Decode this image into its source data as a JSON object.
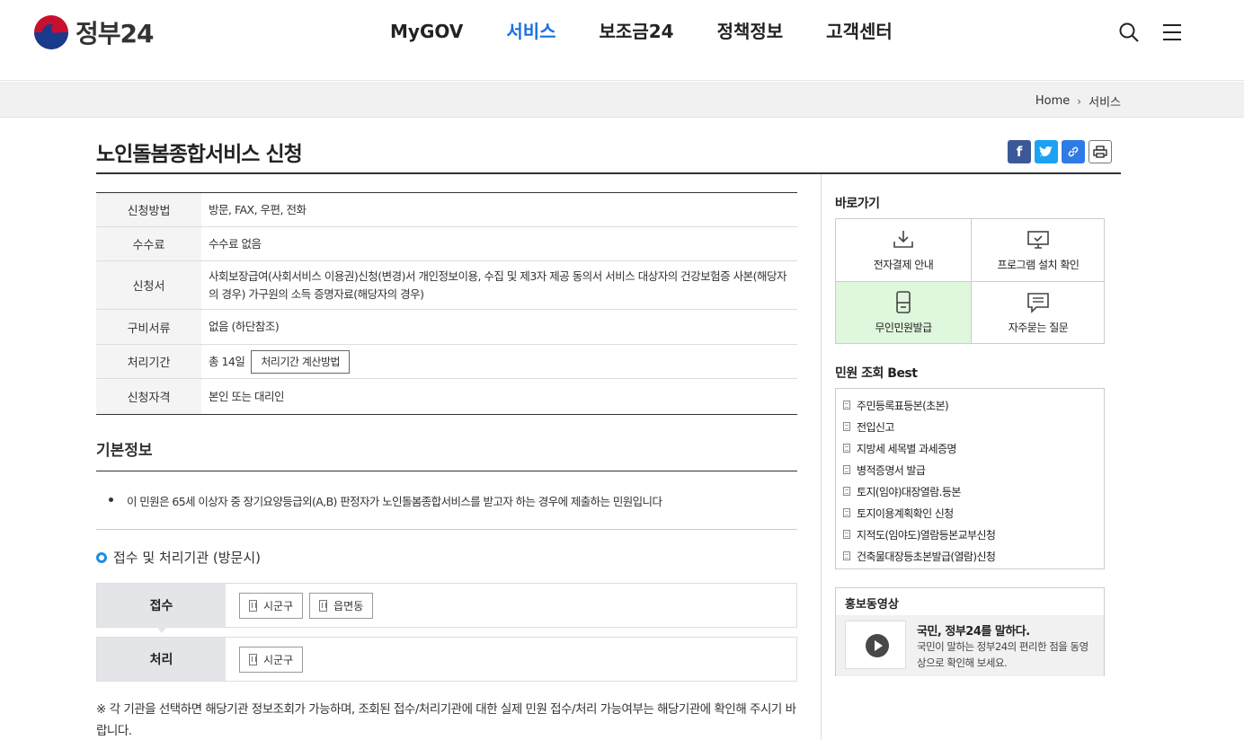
{
  "header": {
    "logo_text": "정부24",
    "nav": [
      "MyGOV",
      "서비스",
      "보조금24",
      "정책정보",
      "고객센터"
    ],
    "active_nav": "서비스"
  },
  "breadcrumb": [
    "Home",
    "서비스"
  ],
  "page": {
    "title": "노인돌봄종합서비스 신청"
  },
  "info": {
    "rows": [
      {
        "label": "신청방법",
        "value": "방문, FAX, 우편, 전화"
      },
      {
        "label": "수수료",
        "value": "수수료 없음"
      },
      {
        "label": "신청서",
        "value": "사회보장급여(사회서비스 이용권)신청(변경)서 개인정보이용, 수집 및 제3자 제공 동의서 서비스 대상자의 건강보험증 사본(해당자의 경우) 가구원의 소득 증명자료(해당자의 경우)"
      },
      {
        "label": "구비서류",
        "value": "없음 (하단참조)"
      },
      {
        "label": "처리기간",
        "value": "총 14일",
        "button": "처리기간 계산방법"
      },
      {
        "label": "신청자격",
        "value": "본인 또는 대리인"
      }
    ]
  },
  "basic": {
    "heading": "기본정보",
    "bullet": "이 민원은 65세 이상자 중 장기요양등급외(A,B) 판정자가 노인돌봄종합서비스를 받고자 하는 경우에 제출하는 민원입니다"
  },
  "agency": {
    "heading": "접수 및 처리기관 (방문시)",
    "receive_label": "접수",
    "receive_buttons": [
      "시군구",
      "읍면동"
    ],
    "process_label": "처리",
    "process_buttons": [
      "시군구"
    ],
    "notice": "※ 각 기관을 선택하면 해당기관 정보조회가 가능하며, 조회된 접수/처리기관에 대한 실제 민원 접수/처리 가능여부는 해당기관에 확인해 주시기 바랍니다."
  },
  "sidebar": {
    "quick_heading": "바로가기",
    "quick": [
      {
        "label": "전자결제 안내",
        "icon": "download-icon"
      },
      {
        "label": "프로그램 설치 확인",
        "icon": "monitor-check-icon"
      },
      {
        "label": "무인민원발급",
        "icon": "kiosk-icon"
      },
      {
        "label": "자주묻는 질문",
        "icon": "chat-icon"
      }
    ],
    "best_heading": "민원 조회 Best",
    "best": [
      "주민등록표등본(초본)",
      "전입신고",
      "지방세 세목별 과세증명",
      "병적증명서 발급",
      "토지(임야)대장열람.등본",
      "토지이용계획확인 신청",
      "지적도(임야도)열람등본교부신청",
      "건축물대장등초본발급(열람)신청"
    ],
    "video_heading": "홍보동영상",
    "video_title": "국민, 정부24를 말하다.",
    "video_desc": "국민이 말하는 정부24의 편리한 점을 동영상으로 확인해 보세요."
  },
  "colors": {
    "accent": "#1d6fe0",
    "highlight_cell": "#dff7dc"
  }
}
